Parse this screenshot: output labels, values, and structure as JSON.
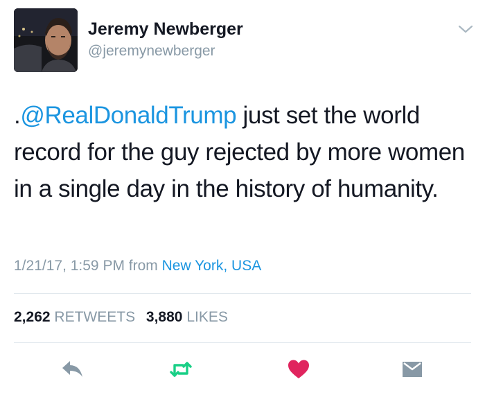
{
  "user": {
    "display_name": "Jeremy Newberger",
    "handle": "@jeremynewberger"
  },
  "tweet": {
    "prefix": ".",
    "mention": "@RealDonaldTrump",
    "text": " just set the world record for the guy rejected by more women in a single day in the history of humanity."
  },
  "meta": {
    "timestamp": "1/21/17, 1:59 PM",
    "from_label": "from",
    "location": "New York, USA"
  },
  "stats": {
    "retweets_count": "2,262",
    "retweets_label": "RETWEETS",
    "likes_count": "3,880",
    "likes_label": "LIKES"
  },
  "icons": {
    "menu": "chevron-down-icon",
    "reply": "reply-icon",
    "retweet": "retweet-icon",
    "like": "heart-icon",
    "message": "envelope-icon"
  },
  "colors": {
    "text": "#141823",
    "secondary": "#8899a6",
    "link": "#1b95e0",
    "retweet": "#19cf86",
    "like": "#e0245e",
    "divider": "#e1e8ed"
  }
}
